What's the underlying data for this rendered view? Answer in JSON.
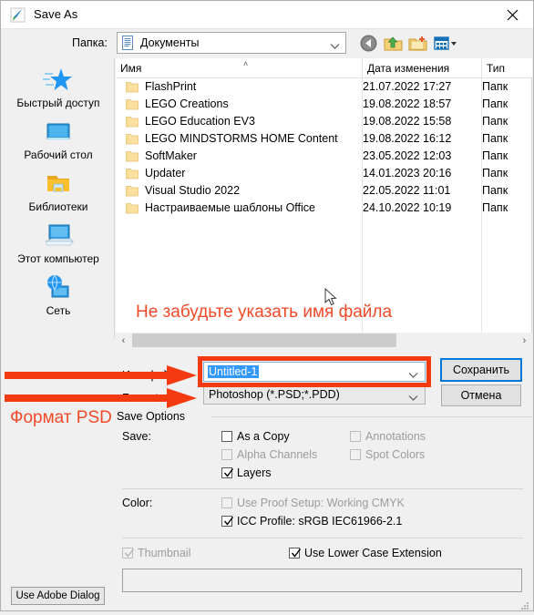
{
  "window": {
    "title": "Save As",
    "icon": "photoshop-feather-icon",
    "close_label": "✕"
  },
  "toolbar": {
    "path_label": "Папка:",
    "path_value": "Документы",
    "icons": [
      "back-icon",
      "up-folder-icon",
      "new-folder-icon",
      "views-icon"
    ]
  },
  "places": [
    {
      "label": "Быстрый доступ",
      "icon": "quick-access-star-icon"
    },
    {
      "label": "Рабочий стол",
      "icon": "desktop-icon"
    },
    {
      "label": "Библиотеки",
      "icon": "libraries-folder-icon"
    },
    {
      "label": "Этот компьютер",
      "icon": "this-pc-icon"
    },
    {
      "label": "Сеть",
      "icon": "network-icon"
    }
  ],
  "filelist": {
    "columns": [
      "Имя",
      "Дата изменения",
      "Тип"
    ],
    "sort_indicator": "˄",
    "rows": [
      {
        "name": "FlashPrint",
        "date": "21.07.2022 17:27",
        "type": "Папк"
      },
      {
        "name": "LEGO Creations",
        "date": "19.08.2022 18:57",
        "type": "Папк"
      },
      {
        "name": "LEGO Education EV3",
        "date": "19.08.2022 15:58",
        "type": "Папк"
      },
      {
        "name": "LEGO MINDSTORMS HOME Content",
        "date": "19.08.2022 16:12",
        "type": "Папк"
      },
      {
        "name": "SoftMaker",
        "date": "23.05.2022 12:03",
        "type": "Папк"
      },
      {
        "name": "Updater",
        "date": "14.01.2023 20:16",
        "type": "Папк"
      },
      {
        "name": "Visual Studio 2022",
        "date": "22.05.2022 11:01",
        "type": "Папк"
      },
      {
        "name": "Настраиваемые шаблоны Office",
        "date": "24.10.2022 10:19",
        "type": "Папк"
      }
    ],
    "scroll_left": "‹",
    "scroll_right": "›"
  },
  "form": {
    "filename_label": "Имя файла:",
    "filename_value": "Untitled-1",
    "format_label": "Format:",
    "format_value": "Photoshop (*.PSD;*.PDD)",
    "save_button": "Сохранить",
    "cancel_button": "Отмена"
  },
  "save_options": {
    "title": "Save Options",
    "save_label": "Save:",
    "color_label": "Color:",
    "checkboxes": {
      "as_a_copy": {
        "label": "As a Copy",
        "checked": false,
        "disabled": false
      },
      "alpha_channels": {
        "label": "Alpha Channels",
        "checked": false,
        "disabled": true
      },
      "layers": {
        "label": "Layers",
        "checked": true,
        "disabled": false
      },
      "annotations": {
        "label": "Annotations",
        "checked": false,
        "disabled": true
      },
      "spot_colors": {
        "label": "Spot Colors",
        "checked": false,
        "disabled": true
      },
      "use_proof_setup": {
        "label": "Use Proof Setup:  Working CMYK",
        "checked": false,
        "disabled": true
      },
      "icc_profile": {
        "label": "ICC Profile:  sRGB IEC61966-2.1",
        "checked": true,
        "disabled": false
      },
      "thumbnail": {
        "label": "Thumbnail",
        "checked": true,
        "disabled": true
      },
      "lower_case_ext": {
        "label": "Use Lower Case Extension",
        "checked": true,
        "disabled": false
      }
    }
  },
  "footer": {
    "adobe_dialog_button": "Use Adobe Dialog"
  },
  "annotations": {
    "note_filename": "Не забудьте указать имя файла",
    "note_format": "Формат PSD",
    "accent_color": "#f43a10"
  }
}
